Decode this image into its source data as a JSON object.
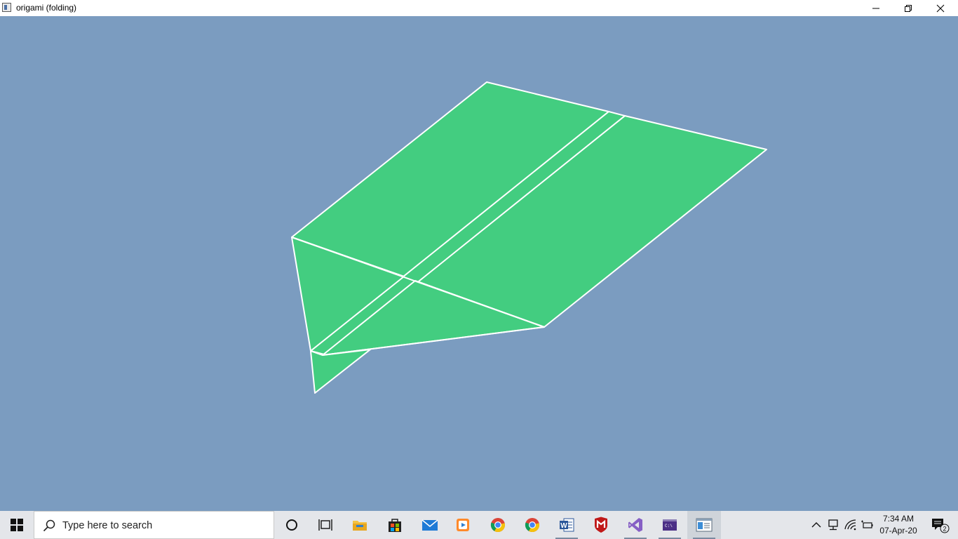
{
  "window": {
    "title": "origami (folding)",
    "controls": {
      "minimize_icon": "minimize-icon",
      "maximize_icon": "restore-icon",
      "close_icon": "close-icon"
    }
  },
  "scene": {
    "background_color": "#7b9cc0",
    "paper_color": "#43cd80",
    "edge_color": "#ffffff",
    "object": "paper-airplane"
  },
  "taskbar": {
    "start_icon": "windows-start-icon",
    "search": {
      "placeholder": "Type here to search",
      "icon": "search-icon"
    },
    "pinned": [
      {
        "name": "cortana",
        "icon": "cortana-circle-icon"
      },
      {
        "name": "task-view",
        "icon": "task-view-icon"
      },
      {
        "name": "file-explorer",
        "icon": "folder-icon"
      },
      {
        "name": "microsoft-store",
        "icon": "store-icon"
      },
      {
        "name": "mail",
        "icon": "mail-icon"
      },
      {
        "name": "media-player",
        "icon": "media-player-icon"
      },
      {
        "name": "chrome",
        "icon": "chrome-icon"
      },
      {
        "name": "chrome-2",
        "icon": "chrome-icon"
      },
      {
        "name": "word",
        "icon": "word-icon"
      },
      {
        "name": "mcafee",
        "icon": "mcafee-icon"
      },
      {
        "name": "visual-studio",
        "icon": "visual-studio-icon"
      },
      {
        "name": "console",
        "icon": "console-icon"
      },
      {
        "name": "origami-app",
        "icon": "app-window-icon"
      }
    ],
    "tray": {
      "chevron_icon": "chevron-up-icon",
      "network_device_icon": "network-icon",
      "wifi_icon": "wifi-icon",
      "battery_icon": "battery-icon",
      "time": "7:34 AM",
      "date": "07-Apr-20",
      "notifications_count": "2"
    }
  }
}
